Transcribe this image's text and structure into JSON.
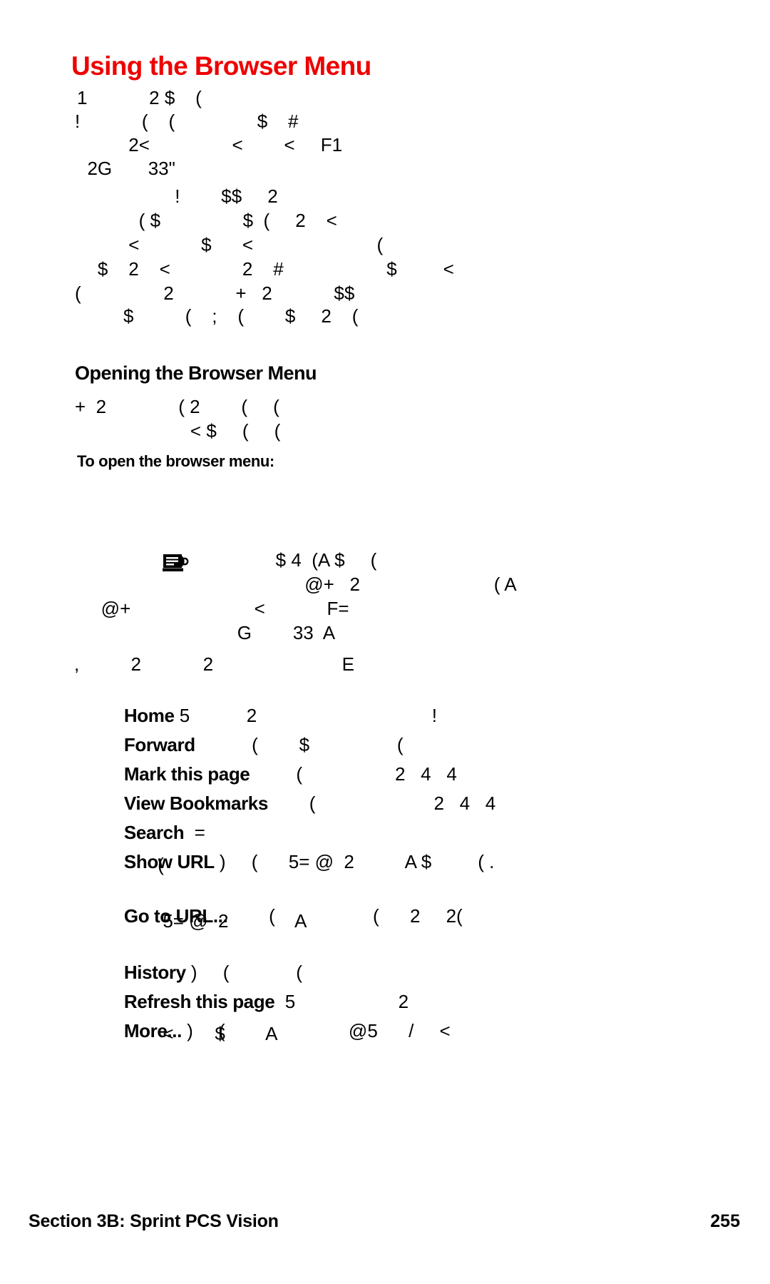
{
  "document": {
    "title": "Using the Browser Menu",
    "title_color": "#ee0000",
    "page_number": "255",
    "footer_left": "Section 3B: Sprint PCS Vision",
    "footer_right": "255"
  },
  "headings": {
    "main": "Using the Browser Menu",
    "section": "Opening the Browser Menu",
    "procedure": "To open the browser menu:"
  },
  "intro_paragraph": {
    "lines": [
      "1            2 $    (",
      "!            (    (                $    #",
      "          2<                <        <     F1",
      "  2G       33\""
    ]
  },
  "second_paragraph": {
    "lines": [
      "                   !        $$     2",
      "            ( $                $  (     2    <",
      "          <            $      <                        (",
      "    $    2    <              2    #                    $         <",
      "(                2            +   2            $$",
      "         $          (    ;    (        $     2    ("
    ]
  },
  "section_paragraph": {
    "lines": [
      "+  2              ( 2        (     (",
      "                      < $     (     ("
    ]
  },
  "procedure_paragraph": {
    "icon": "phone-device-icon",
    "lines": [
      "            $ 4  (A $     (",
      "                   @+   2                          ( A",
      "   @+                        <            F=",
      "                 G        33  A"
    ]
  },
  "list_intro": {
    "line": ",          2            2                         E"
  },
  "menu_items": [
    {
      "term": "Home",
      "rest": " 5           2                                  !",
      "continuations": []
    },
    {
      "term": "Forward",
      "rest": "           (        $                 (",
      "continuations": []
    },
    {
      "term": "Mark this page",
      "rest": "         (                  2   4   4",
      "continuations": []
    },
    {
      "term": "View Bookmarks",
      "rest": "        (                       2   4   4",
      "continuations": []
    },
    {
      "term": "Search",
      "rest": "  =",
      "continuations": []
    },
    {
      "term": "Show URL",
      "rest": " )     (      5= @  2          A $         ( .",
      "continuations": [
        "     ("
      ]
    },
    {
      "term": "Go to URL...",
      "rest": "        (                   (      2     2(",
      "continuations": [
        "      5= @  2             A"
      ]
    },
    {
      "term": "History",
      "rest": " )     (             (",
      "continuations": []
    },
    {
      "term": "Refresh this page",
      "rest": "  5                    2",
      "continuations": []
    },
    {
      "term": "More...",
      "rest": " )     (                        @5      /     <",
      "continuations": [
        "      <        $        A"
      ]
    }
  ]
}
